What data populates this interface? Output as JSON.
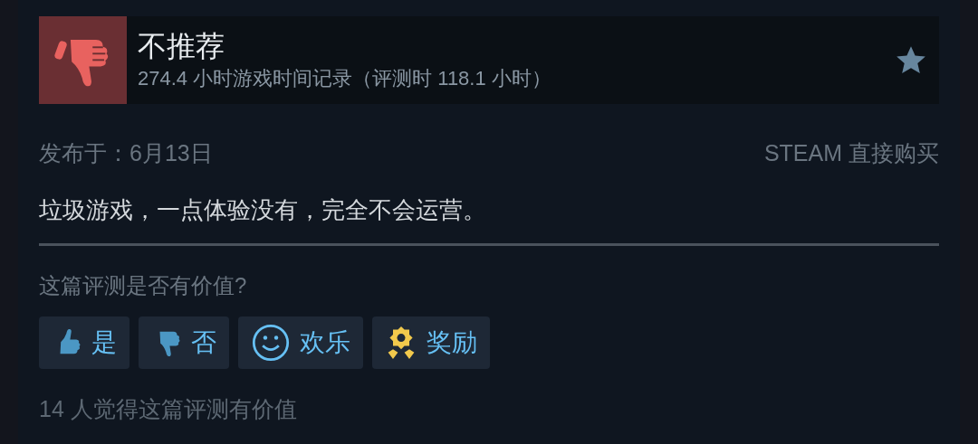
{
  "review": {
    "verdict": {
      "kind": "not_recommended",
      "label": "不推荐"
    },
    "playtime": "274.4 小时游戏时间记录（评测时 118.1 小时）",
    "posted": "发布于：6月13日",
    "source": "STEAM 直接购买",
    "body": "垃圾游戏，一点体验没有，完全不会运营。"
  },
  "feedback": {
    "question": "这篇评测是否有价值?",
    "buttons": [
      {
        "kind": "yes",
        "label": "是"
      },
      {
        "kind": "no",
        "label": "否"
      },
      {
        "kind": "funny",
        "label": "欢乐"
      },
      {
        "kind": "award",
        "label": "奖励"
      }
    ],
    "helpful_count": "14 人觉得这篇评测有价值"
  }
}
